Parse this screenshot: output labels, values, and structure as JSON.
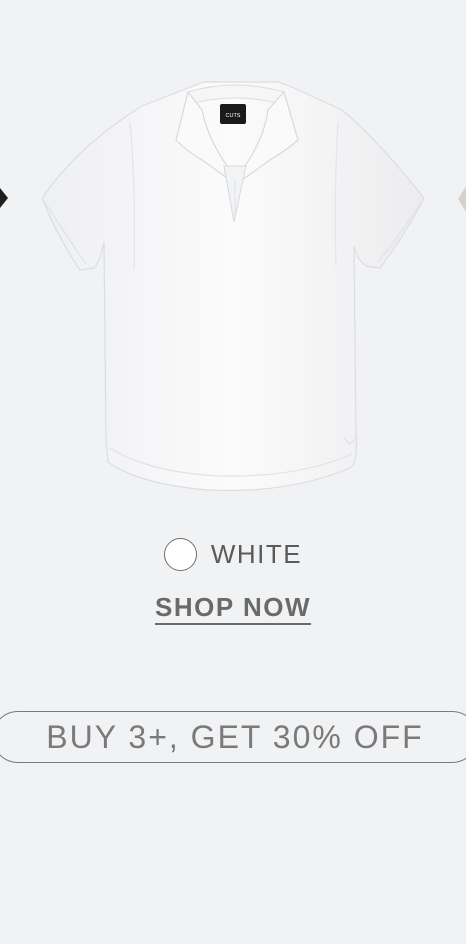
{
  "product": {
    "brand_tag": "CUTS",
    "color_name": "WHITE",
    "swatch_color": "#ffffff",
    "cta_label": "SHOP NOW"
  },
  "carousel": {
    "prev_icon": "chevron-left-icon",
    "next_icon": "chevron-right-icon",
    "next_preview_color": "#d9d2ca"
  },
  "promo": {
    "text": "BUY 3+, GET 30% OFF"
  }
}
